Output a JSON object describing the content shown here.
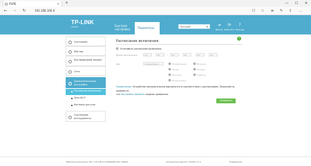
{
  "browser": {
    "tab_title": "XVAE",
    "url": "192.168.100.0",
    "tab_close": "✕",
    "new_tab": "+",
    "controls": {
      "minimize": "—",
      "maximize": "☐",
      "close": "✕"
    },
    "nav": {
      "back": "←",
      "forward": "→",
      "refresh": "↻"
    },
    "tools": {
      "reading": "☐",
      "favorite": "☆",
      "hub": "≡",
      "note": "✎",
      "share": "⇪",
      "more": "…"
    }
  },
  "router": {
    "logo": "TP-LINK",
    "model": "XXXXX",
    "tabs": [
      {
        "label": "Быстрая настройка"
      },
      {
        "label": "Параметры"
      }
    ],
    "language": "Русский",
    "header_buttons": [
      {
        "icon": "logout-icon",
        "glyph": "⇥",
        "label": "Выход"
      },
      {
        "icon": "reboot-icon",
        "glyph": "⟳",
        "label": "Перезагр."
      },
      {
        "icon": "help-icon",
        "glyph": "?",
        "label": "Помощь"
      }
    ]
  },
  "sidebar": {
    "items": [
      {
        "label": "Состояние",
        "icon": "status-icon"
      },
      {
        "label": "Мастер",
        "icon": "wizard-icon"
      },
      {
        "label": "Беспроводной режим",
        "icon": "wireless-icon"
      },
      {
        "label": "Сеть",
        "icon": "network-icon"
      },
      {
        "label": "Дополнительные настройки",
        "icon": "settings-icon"
      },
      {
        "label": "Системные инструменты",
        "icon": "tools-icon"
      }
    ],
    "subitems": [
      {
        "label": "Расписание включения"
      },
      {
        "label": "Зона Wi-Fi"
      },
      {
        "label": "Контроль доступа"
      }
    ]
  },
  "content": {
    "title": "Расписание включения",
    "help": "?",
    "enable_label": "Установить расписание включения",
    "time_label": "Время выключения",
    "days_label": "Дни",
    "time_fields": [
      "00",
      "00",
      "00",
      "00"
    ],
    "time_fields_2": [
      "00",
      "00"
    ],
    "days_select": "каждый день",
    "weekdays": [
      "Понедельник",
      "Вторник",
      "Среда",
      "Четверг",
      "Пятница",
      "Суббота",
      "Воскресенье"
    ],
    "note_title": "Примечание:",
    "note_text": "Устройство автоматически выключится в соответствии с расписанием. Пожалуйста, проверьте,",
    "note_text2": "что",
    "note_link": "Настройки времени",
    "note_text3": "заданы правильно.",
    "save": "Сохранить"
  },
  "footer": {
    "firmware": "Версия встроенного ПО: 1.0.0 Build 20160000 Rel. 00000",
    "hardware": "Аппаратная версия: XXXXX v1.0",
    "support": "Поддержка"
  }
}
